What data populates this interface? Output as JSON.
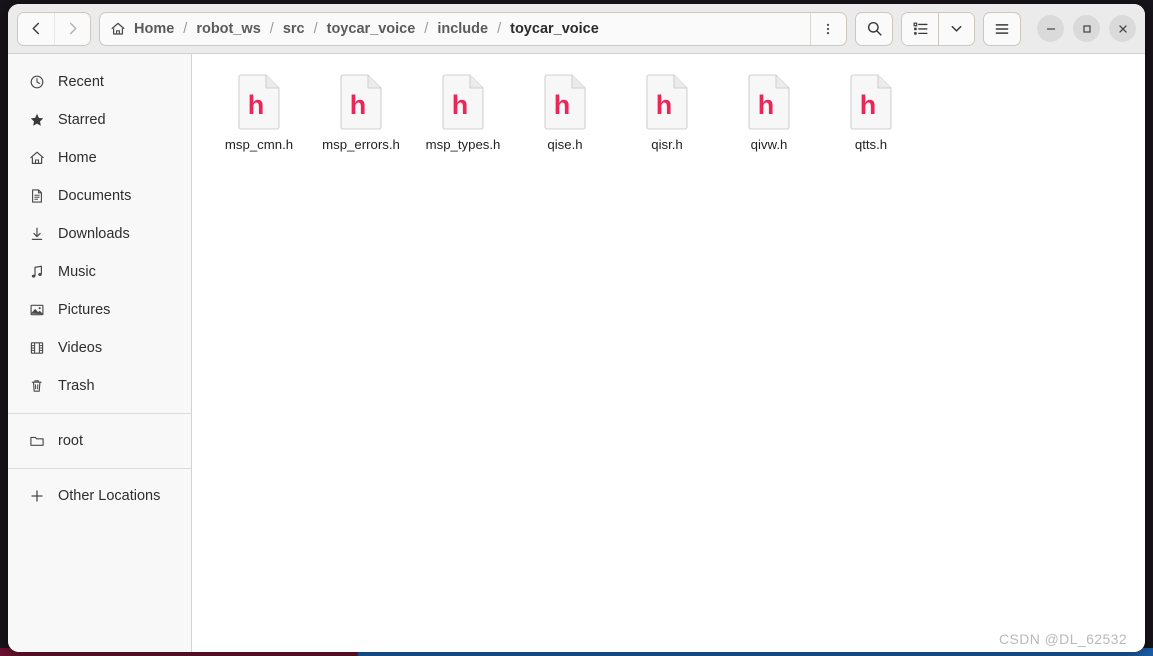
{
  "window": {
    "title": "toycar_voice",
    "controls": {
      "minimize": "−",
      "maximize": "□",
      "close": "×"
    }
  },
  "header": {
    "back_label": "‹",
    "forward_label": "›",
    "home_icon": "home-icon",
    "breadcrumbs": [
      {
        "label": "Home",
        "current": false
      },
      {
        "label": "robot_ws",
        "current": false
      },
      {
        "label": "src",
        "current": false
      },
      {
        "label": "toycar_voice",
        "current": false
      },
      {
        "label": "include",
        "current": false
      },
      {
        "label": "toycar_voice",
        "current": true
      }
    ],
    "separator": "/",
    "path_menu_icon": "kebab-menu-icon",
    "search_icon": "search-icon",
    "view_list_icon": "list-view-icon",
    "view_chevron_icon": "chevron-down-icon",
    "hamburger_icon": "hamburger-menu-icon"
  },
  "sidebar": {
    "groups": [
      {
        "items": [
          {
            "label": "Recent",
            "icon": "clock-icon"
          },
          {
            "label": "Starred",
            "icon": "star-icon"
          },
          {
            "label": "Home",
            "icon": "home-icon"
          },
          {
            "label": "Documents",
            "icon": "document-icon"
          },
          {
            "label": "Downloads",
            "icon": "download-icon"
          },
          {
            "label": "Music",
            "icon": "music-note-icon"
          },
          {
            "label": "Pictures",
            "icon": "picture-icon"
          },
          {
            "label": "Videos",
            "icon": "video-icon"
          },
          {
            "label": "Trash",
            "icon": "trash-icon"
          }
        ]
      },
      {
        "items": [
          {
            "label": "root",
            "icon": "folder-icon"
          }
        ]
      },
      {
        "items": [
          {
            "label": "Other Locations",
            "icon": "plus-icon"
          }
        ]
      }
    ]
  },
  "files": [
    {
      "name": "msp_cmn.h",
      "type": "header-file",
      "glyph": "h"
    },
    {
      "name": "msp_errors.h",
      "type": "header-file",
      "glyph": "h"
    },
    {
      "name": "msp_types.h",
      "type": "header-file",
      "glyph": "h"
    },
    {
      "name": "qise.h",
      "type": "header-file",
      "glyph": "h"
    },
    {
      "name": "qisr.h",
      "type": "header-file",
      "glyph": "h"
    },
    {
      "name": "qivw.h",
      "type": "header-file",
      "glyph": "h"
    },
    {
      "name": "qtts.h",
      "type": "header-file",
      "glyph": "h"
    }
  ],
  "watermark": "CSDN @DL_62532",
  "colors": {
    "header_bg": "#ebebeb",
    "sidebar_bg": "#f8f8f8",
    "content_bg": "#ffffff",
    "file_glyph": "#e8275a",
    "desktop": "#2e0f20",
    "status_strip_blue": "#1a5fa8"
  }
}
